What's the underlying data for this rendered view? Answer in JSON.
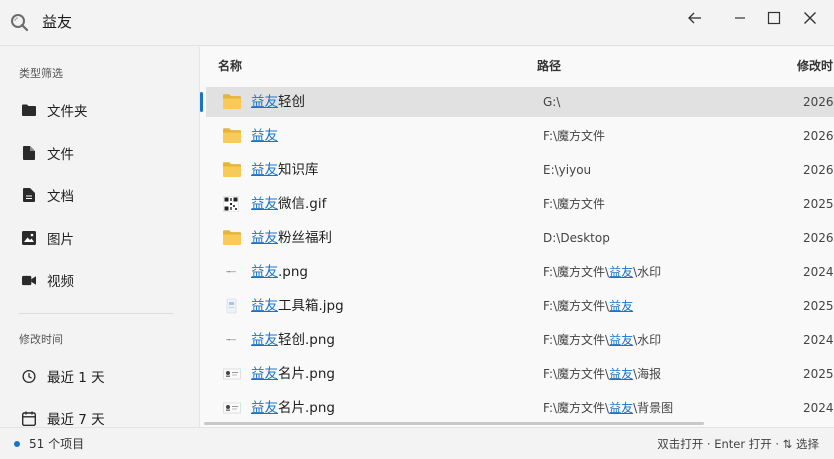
{
  "search": {
    "query": "益友"
  },
  "sidebar": {
    "type_heading": "类型筛选",
    "type_items": [
      {
        "label": "文件夹",
        "icon": "folder-icon"
      },
      {
        "label": "文件",
        "icon": "file-icon"
      },
      {
        "label": "文档",
        "icon": "document-icon"
      },
      {
        "label": "图片",
        "icon": "image-icon"
      },
      {
        "label": "视频",
        "icon": "video-icon"
      }
    ],
    "time_heading": "修改时间",
    "time_items": [
      {
        "label": "最近 1 天",
        "icon": "clock-icon"
      },
      {
        "label": "最近 7 天",
        "icon": "calendar-icon"
      }
    ]
  },
  "table": {
    "columns": {
      "name": "名称",
      "path": "路径",
      "modified": "修改时"
    },
    "rows": [
      {
        "hl": "益友",
        "rest": "轻创",
        "path_pre": "G:\\",
        "path_hl": "",
        "path_post": "",
        "date": "2026",
        "icon": "folder-icon",
        "selected": true
      },
      {
        "hl": "益友",
        "rest": "",
        "path_pre": "F:\\魔方文件",
        "path_hl": "",
        "path_post": "",
        "date": "2026",
        "icon": "folder-icon"
      },
      {
        "hl": "益友",
        "rest": "知识库",
        "path_pre": "E:\\yiyou",
        "path_hl": "",
        "path_post": "",
        "date": "2026",
        "icon": "folder-icon"
      },
      {
        "hl": "益友",
        "rest": "微信.gif",
        "path_pre": "F:\\魔方文件",
        "path_hl": "",
        "path_post": "",
        "date": "2025",
        "icon": "qr-image-icon"
      },
      {
        "hl": "益友",
        "rest": "粉丝福利",
        "path_pre": "D:\\Desktop",
        "path_hl": "",
        "path_post": "",
        "date": "2026",
        "icon": "folder-icon"
      },
      {
        "hl": "益友",
        "rest": ".png",
        "path_pre": "F:\\魔方文件\\",
        "path_hl": "益友",
        "path_post": "\\水印",
        "date": "2024",
        "icon": "png-thumb-icon"
      },
      {
        "hl": "益友",
        "rest": "工具箱.jpg",
        "path_pre": "F:\\魔方文件\\",
        "path_hl": "益友",
        "path_post": "",
        "date": "2025",
        "icon": "jpg-thumb-icon"
      },
      {
        "hl": "益友",
        "rest": "轻创.png",
        "path_pre": "F:\\魔方文件\\",
        "path_hl": "益友",
        "path_post": "\\水印",
        "date": "2024",
        "icon": "png-thumb-icon"
      },
      {
        "hl": "益友",
        "rest": "名片.png",
        "path_pre": "F:\\魔方文件\\",
        "path_hl": "益友",
        "path_post": "\\海报",
        "date": "2025",
        "icon": "card-thumb-icon"
      },
      {
        "hl": "益友",
        "rest": "名片.png",
        "path_pre": "F:\\魔方文件\\",
        "path_hl": "益友",
        "path_post": "\\背景图",
        "date": "2024",
        "icon": "card-thumb-icon"
      }
    ]
  },
  "status": {
    "count": "51 个项目",
    "hints": "双击打开 · Enter 打开 · ⇅ 选择"
  },
  "colors": {
    "accent": "#1a73c8",
    "folder": "#f5c542"
  }
}
